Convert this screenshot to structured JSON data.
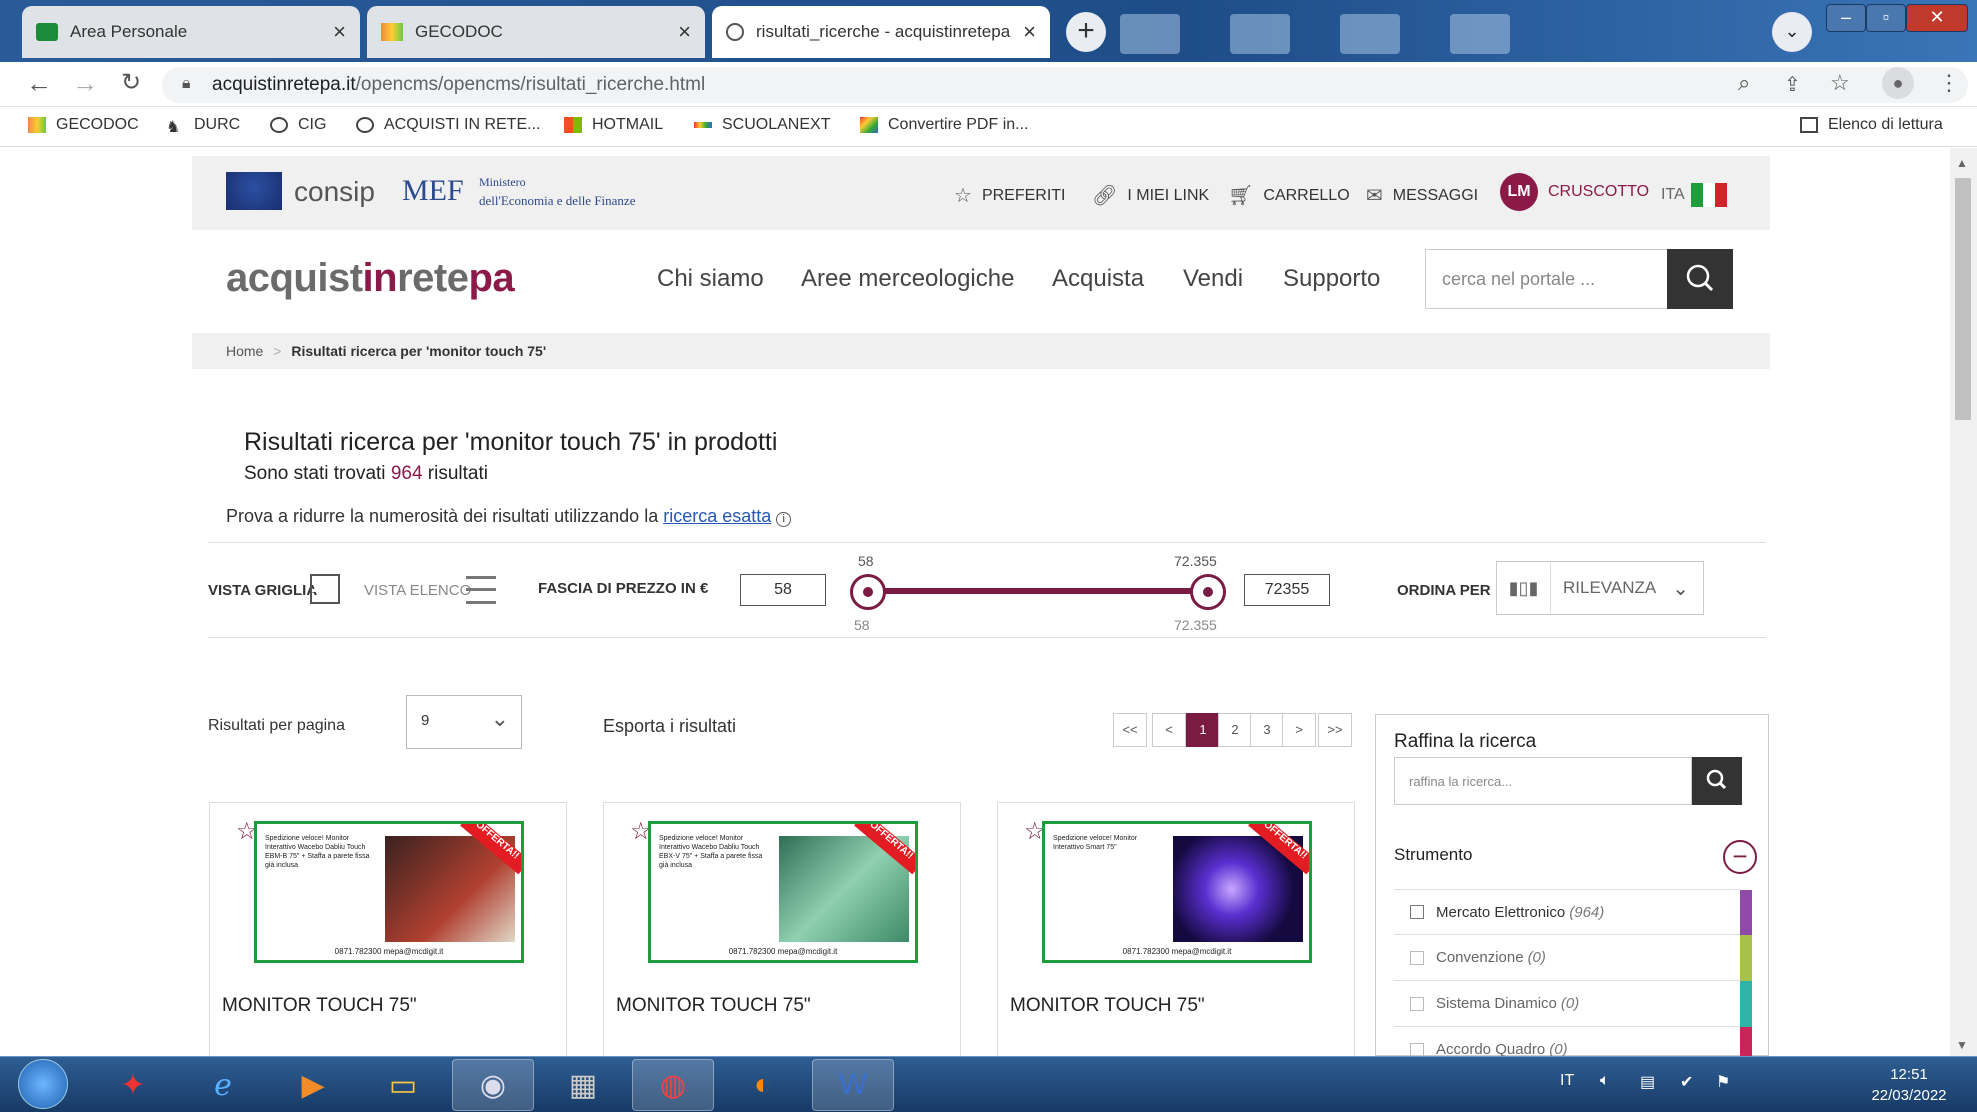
{
  "browser": {
    "tabs": [
      {
        "label": "Area Personale",
        "close": "×"
      },
      {
        "label": "GECODOC",
        "close": "×"
      },
      {
        "label": "risultati_ricerche - acquistinretepa",
        "close": "×"
      }
    ],
    "new_tab": "+",
    "url_domain": "acquistinretepa.it",
    "url_path": "/opencms/opencms/risultati_ricerche.html",
    "bookmarks": [
      "GECODOC",
      "DURC",
      "CIG",
      "ACQUISTI IN RETE...",
      "HOTMAIL",
      "SCUOLANEXT",
      "Convertire PDF in..."
    ],
    "reading_list": "Elenco di lettura"
  },
  "site": {
    "consip": "consip",
    "mef": "MEF",
    "mef_sub1": "Ministero",
    "mef_sub2": "dell'Economia e delle Finanze",
    "top_links": [
      "PREFERITI",
      "I MIEI LINK",
      "CARRELLO",
      "MESSAGGI",
      "CRUSCOTTO"
    ],
    "user_initials": "LM",
    "lang": "ITA",
    "logo_a": "acquist",
    "logo_b": "in",
    "logo_c": "rete",
    "logo_d": "pa",
    "nav": [
      "Chi siamo",
      "Aree merceologiche",
      "Acquista",
      "Vendi",
      "Supporto"
    ],
    "search_placeholder": "cerca nel portale ..."
  },
  "breadcrumb": {
    "home": "Home",
    "sep": ">",
    "current": "Risultati ricerca per 'monitor touch 75'"
  },
  "results": {
    "title": "Risultati ricerca per 'monitor touch 75' in prodotti",
    "found_pre": "Sono stati trovati",
    "found_count": "964",
    "found_post": "risultati",
    "hint_pre": "Prova a ridurre la numerosità dei risultati utilizzando la",
    "hint_link": "ricerca esatta"
  },
  "filters": {
    "grid_label": "VISTA GRIGLIA",
    "list_label": "VISTA ELENCO",
    "price_label": "FASCIA DI PREZZO IN €",
    "price_min": "58",
    "price_max": "72355",
    "tick_min": "58",
    "tick_max": "72.355",
    "sort_label": "ORDINA PER",
    "sort_value": "RILEVANZA"
  },
  "listing": {
    "per_page_label": "Risultati per pagina",
    "per_page_value": "9",
    "export": "Esporta i risultati",
    "pager": [
      "<<",
      "<",
      "1",
      "2",
      "3",
      ">",
      ">>"
    ],
    "current_page": "1"
  },
  "products": [
    {
      "title": "MONITOR TOUCH 75\"",
      "banner": "OFFERTA!!",
      "blurb": "Spedizione veloce! Monitor Interattivo Wacebo Dabliu Touch EBM-B 75\" + Staffa a parete fissa già inclusa",
      "footer": "0871.782300   mepa@mcdigit.it"
    },
    {
      "title": "MONITOR TOUCH 75\"",
      "banner": "OFFERTA!!",
      "blurb": "Spedizione veloce! Monitor Interattivo Wacebo Dabliu Touch EBX-V 75\" + Staffa a parete fissa già inclusa",
      "footer": "0871.782300   mepa@mcdigit.it"
    },
    {
      "title": "MONITOR TOUCH 75\"",
      "banner": "OFFERTA!!",
      "blurb": "Spedizione veloce! Monitor Interattivo Smart 75\"",
      "footer": "0871.782300   mepa@mcdigit.it"
    }
  ],
  "refine": {
    "title": "Raffina la ricerca",
    "placeholder": "raffina la ricerca...",
    "section": "Strumento",
    "items": [
      {
        "label": "Mercato Elettronico",
        "count": "(964)",
        "color": "#8e4aa6"
      },
      {
        "label": "Convenzione",
        "count": "(0)",
        "color": "#a6c24a"
      },
      {
        "label": "Sistema Dinamico",
        "count": "(0)",
        "color": "#2fb3a6"
      },
      {
        "label": "Accordo Quadro",
        "count": "(0)",
        "color": "#c8265a"
      }
    ]
  },
  "taskbar": {
    "lang": "IT",
    "time": "12:51",
    "date": "22/03/2022"
  }
}
